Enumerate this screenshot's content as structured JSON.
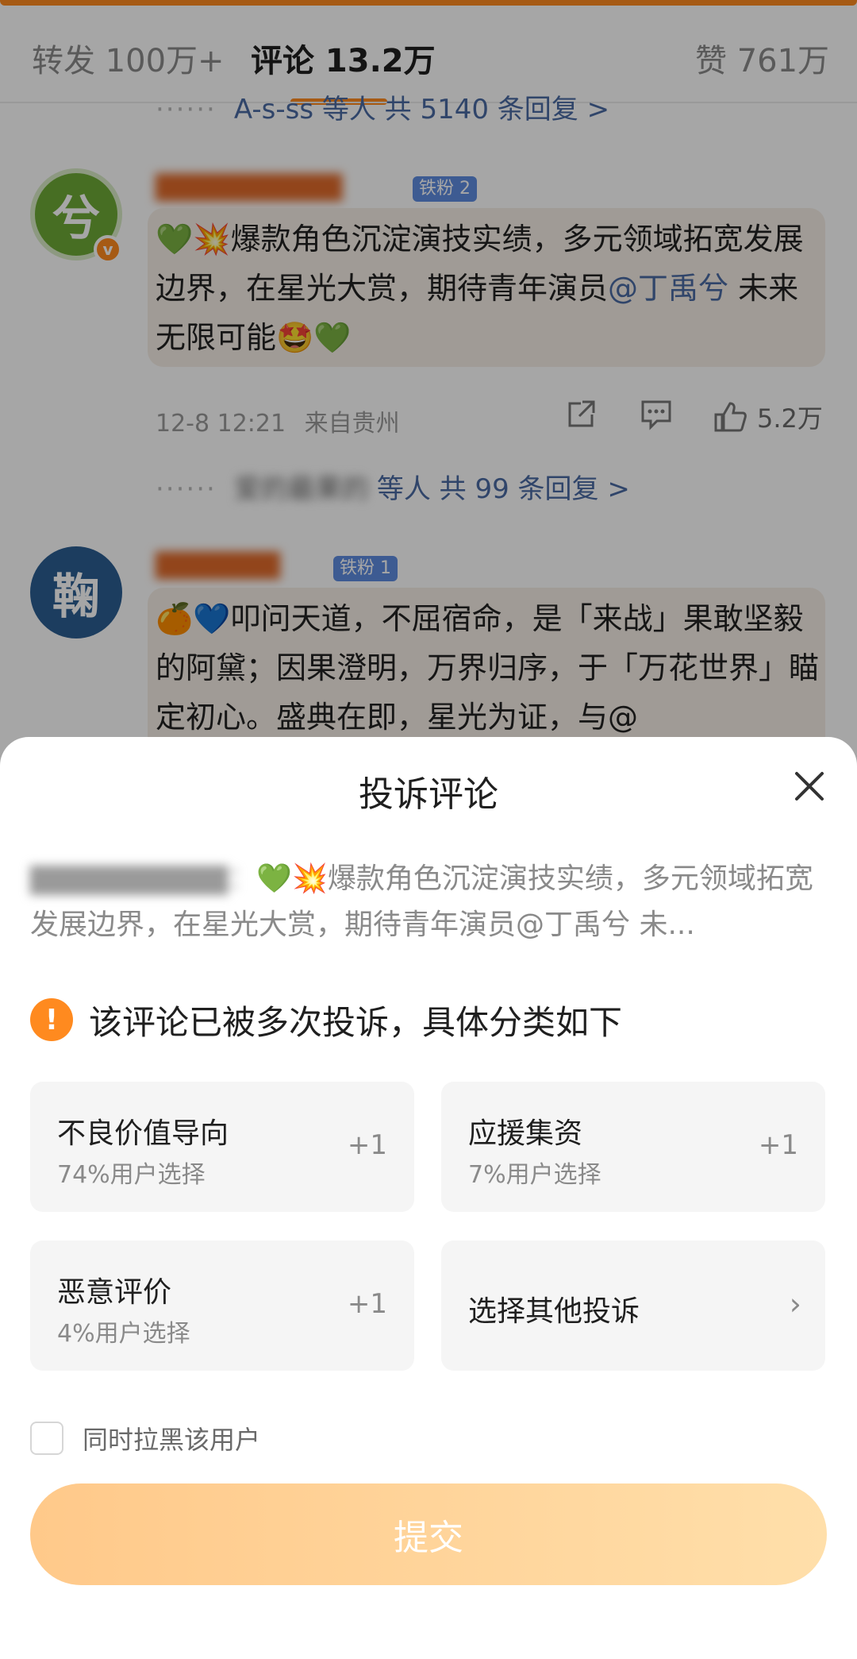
{
  "tabs": [
    {
      "label": "转发 100万+"
    },
    {
      "label": "评论 13.2万"
    },
    {
      "label": "赞 761万"
    }
  ],
  "feed": {
    "reply_link_1": "A-s-ss 等人  共 5140 条回复 >",
    "comment1": {
      "avatar_char": "兮",
      "fan_badge": "铁粉 2",
      "text_a": "💚💥爆款角色沉淀演技实绩，多元领域拓宽发展边界，在星光大赏，期待青年演员",
      "mention": "@丁禹兮",
      "text_b": " 未来无限可能🤩💚",
      "time": "12-8 12:21",
      "location": "来自贵州",
      "likes": "5.2万",
      "reply_summary_blur": "爱的最果的",
      "reply_summary": "等人  共 99 条回复 >"
    },
    "comment2": {
      "avatar_char": "鞠",
      "fan_badge": "铁粉 1",
      "text": "🍊💙叩问天道，不屈宿命，是「来战」果敢坚毅的阿黛；因果澄明，万界归序，于「万花世界」瞄定初心。盛典在即，星光为证，与@"
    }
  },
  "sheet": {
    "title": "投诉评论",
    "quote_text": "💚💥爆款角色沉淀演技实绩，多元领域拓宽发展边界，在星光大赏，期待青年演员@丁禹兮 未...",
    "warning": "该评论已被多次投诉，具体分类如下",
    "options": [
      {
        "title": "不良价值导向",
        "sub": "74%用户选择",
        "plus": "+1"
      },
      {
        "title": "应援集资",
        "sub": "7%用户选择",
        "plus": "+1"
      },
      {
        "title": "恶意评价",
        "sub": "4%用户选择",
        "plus": "+1"
      }
    ],
    "other": "选择其他投诉",
    "block_label": "同时拉黑该用户",
    "submit": "提交"
  },
  "colors": {
    "accent": "#ff8a1f",
    "mention": "#4a6aa3",
    "submit_gradient_start": "#ffc98a",
    "submit_gradient_end": "#ffdfaa"
  }
}
